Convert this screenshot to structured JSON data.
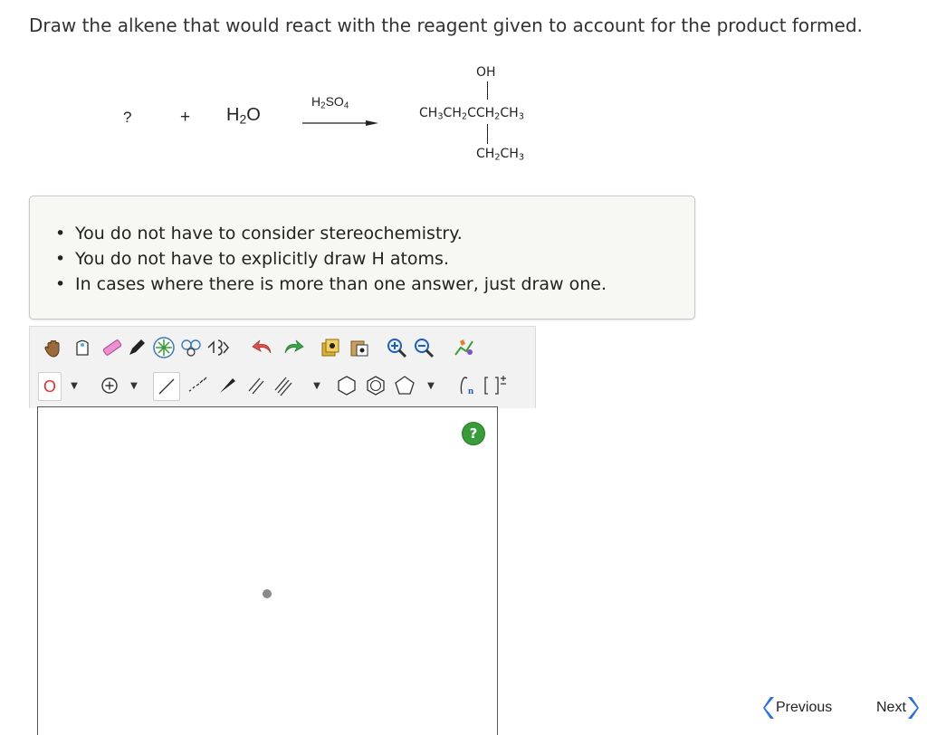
{
  "question": {
    "text": "Draw the alkene that would react with the reagent given to account for the product formed."
  },
  "reaction": {
    "unknown": "?",
    "plus": "+",
    "water": {
      "main": "H",
      "sub": "2",
      "tail": "O"
    },
    "reagent": {
      "h": "H",
      "h_sub": "2",
      "so": "SO",
      "so_sub": "4"
    },
    "product": {
      "top": "OH",
      "chain": [
        "CH",
        "3",
        "CH",
        "2",
        "CCH",
        "2",
        "CH",
        "3"
      ],
      "bottom": [
        "CH",
        "2",
        "CH",
        "3"
      ]
    }
  },
  "instructions": [
    "You do not have to consider stereochemistry.",
    "You do not have to explicitly draw H atoms.",
    "In cases where there is more than one answer, just draw one."
  ],
  "toolbar": {
    "element_symbol": "O",
    "polymer_label": "n",
    "help_label": "?"
  },
  "navigation": {
    "previous": "Previous",
    "next": "Next"
  },
  "colors": {
    "accent": "#2f6fd6",
    "help": "#3a9b3a",
    "element": "#e03030"
  }
}
